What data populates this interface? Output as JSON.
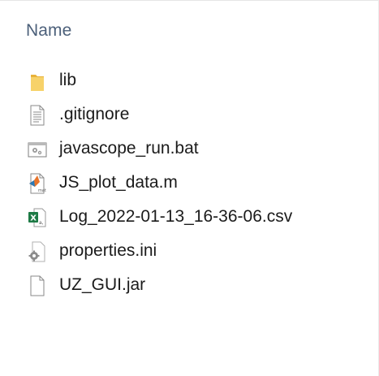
{
  "header": {
    "name_column": "Name"
  },
  "files": [
    {
      "name": "lib",
      "icon": "folder-icon"
    },
    {
      "name": ".gitignore",
      "icon": "text-file-icon"
    },
    {
      "name": "javascope_run.bat",
      "icon": "batch-file-icon"
    },
    {
      "name": "JS_plot_data.m",
      "icon": "matlab-file-icon"
    },
    {
      "name": "Log_2022-01-13_16-36-06.csv",
      "icon": "excel-file-icon"
    },
    {
      "name": "properties.ini",
      "icon": "settings-file-icon"
    },
    {
      "name": "UZ_GUI.jar",
      "icon": "blank-file-icon"
    }
  ],
  "colors": {
    "header_text": "#4c607a",
    "item_text": "#1b1b1b",
    "folder": "#f2c94c",
    "excel": "#1d7a45"
  }
}
